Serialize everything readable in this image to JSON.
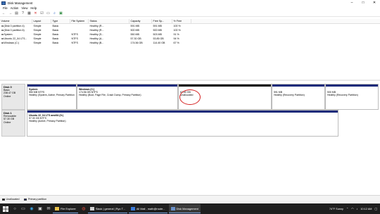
{
  "window": {
    "title": "Disk Management"
  },
  "menu": [
    "File",
    "Action",
    "View",
    "Help"
  ],
  "volumes": {
    "headers": [
      "Volume",
      "Layout",
      "Type",
      "File System",
      "Status",
      "Capacity",
      "Free Sp...",
      "% Free"
    ],
    "rows": [
      [
        "(Disk 0 partition 4)",
        "Simple",
        "Basic",
        "",
        "Healthy (R...",
        "591 MB",
        "591 MB",
        "100 %"
      ],
      [
        "(Disk 0 partition 6)",
        "Simple",
        "Basic",
        "",
        "Healthy (R...",
        "500 MB",
        "500 MB",
        "100 %"
      ],
      [
        "System",
        "Simple",
        "Basic",
        "NTFS",
        "Healthy (S...",
        "550 MB",
        "503 MB",
        "91 %"
      ],
      [
        "Ubuntu 22_04 LTS...",
        "Simple",
        "Basic",
        "NTFS",
        "Healthy (A...",
        "57.30 GB",
        "53.85 GB",
        "94 %"
      ],
      [
        "Windows (C:)",
        "Simple",
        "Basic",
        "NTFS",
        "Healthy (B...",
        "174.56 GB",
        "114.40 GB",
        "67 %"
      ]
    ]
  },
  "disks": [
    {
      "name": "Disk 0",
      "lines": [
        "Basic",
        "238.47 GB",
        "Online"
      ],
      "partitions": [
        {
          "title": "System",
          "lines": [
            "550 MB NTFS",
            "Healthy (System, Active, Primary Partition)"
          ]
        },
        {
          "title": "Windows (C:)",
          "lines": [
            "174.56 GB NTFS",
            "Healthy (Boot, Page File, Crash Dump, Primary Partition)"
          ]
        },
        {
          "title": "",
          "lines": [
            "62.50 GB",
            "Unallocated"
          ]
        },
        {
          "title": "",
          "lines": [
            "591 MB",
            "Healthy (Recovery Partition)"
          ]
        },
        {
          "title": "",
          "lines": [
            "500 MB",
            "Healthy (Recovery Partition)"
          ]
        }
      ]
    },
    {
      "name": "Disk 1",
      "lines": [
        "Removable",
        "57.30 GB",
        "Online"
      ],
      "partitions": [
        {
          "title": "Ubuntu 22_04 LTS amd64 (D:)",
          "lines": [
            "57.30 GB NTFS",
            "Healthy (Active, Primary Partition)"
          ]
        }
      ]
    }
  ],
  "legend": [
    {
      "label": "Unallocated",
      "color": "#111111"
    },
    {
      "label": "Primary partition",
      "color": "#1a2b7a"
    }
  ],
  "taskbar": {
    "tasks": [
      "File Explorer",
      "Slack | general | Ryo T...",
      "All Mail - math@route...",
      "Disk Management"
    ],
    "weather": "74°F  Sunny",
    "time": "10:12 AM"
  },
  "colors": {
    "primary": "#1a2b7a",
    "unallocated": "#111111",
    "highlight": "#d42020",
    "taskbar": "#1f1f1f"
  }
}
